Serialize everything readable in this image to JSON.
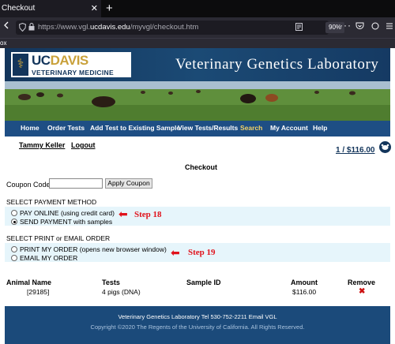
{
  "browser": {
    "tab_title": "Checkout",
    "close_glyph": "✕",
    "new_tab_glyph": "+",
    "url_prefix": "https://www.vgl.",
    "url_host": "ucdavis.edu",
    "url_path": "/myvgl/checkout.htm",
    "zoom": "90%",
    "bookmark": "ox",
    "icons": [
      "back-icon",
      "forward-icon",
      "reload-icon",
      "shield-icon",
      "lock-icon",
      "reader-icon",
      "more-icon",
      "pocket-icon",
      "extensions-icon"
    ]
  },
  "header": {
    "uc": "UC",
    "davis": "DAVIS",
    "vetmed": "VETERINARY MEDICINE",
    "title": "Veterinary Genetics Laboratory"
  },
  "menu": {
    "items": [
      "Home",
      "Order Tests",
      "Add Test to Existing Sample",
      "View Tests/Results",
      "Search",
      "My Account",
      "Help"
    ],
    "active": "Search"
  },
  "user": {
    "name": "Tammy Keller",
    "logout": "Logout",
    "cart": "1 / $116.00"
  },
  "checkout": {
    "title": "Checkout",
    "coupon_label": "Coupon Code",
    "coupon_value": "",
    "coupon_button": "Apply Coupon",
    "payment_label": "SELECT PAYMENT METHOD",
    "payment_options": [
      "PAY ONLINE (using credit card)",
      "SEND PAYMENT with samples"
    ],
    "payment_selected": 1,
    "order_label": "SELECT PRINT or EMAIL ORDER",
    "order_options": [
      "PRINT MY ORDER (opens new browser window)",
      "EMAIL MY ORDER"
    ],
    "order_selected": -1,
    "step18": "Step 18",
    "step19": "Step 19"
  },
  "table": {
    "headers": [
      "Animal Name",
      "Tests",
      "Sample ID",
      "Amount",
      "Remove"
    ],
    "rows": [
      {
        "animal": "[29185]",
        "tests": "4 pigs (DNA)",
        "sample_id": "",
        "amount": "$116.00",
        "remove": "✖"
      }
    ]
  },
  "footer": {
    "line1": "Veterinary Genetics Laboratory  Tel 530-752-2211  Email VGL",
    "line2": "Copyright ©2020 The Regents of the University of California. All Rights Reserved."
  },
  "colors": {
    "accent": "#1e4e84",
    "active_menu": "#f2d266",
    "step_red": "#e0121b"
  }
}
